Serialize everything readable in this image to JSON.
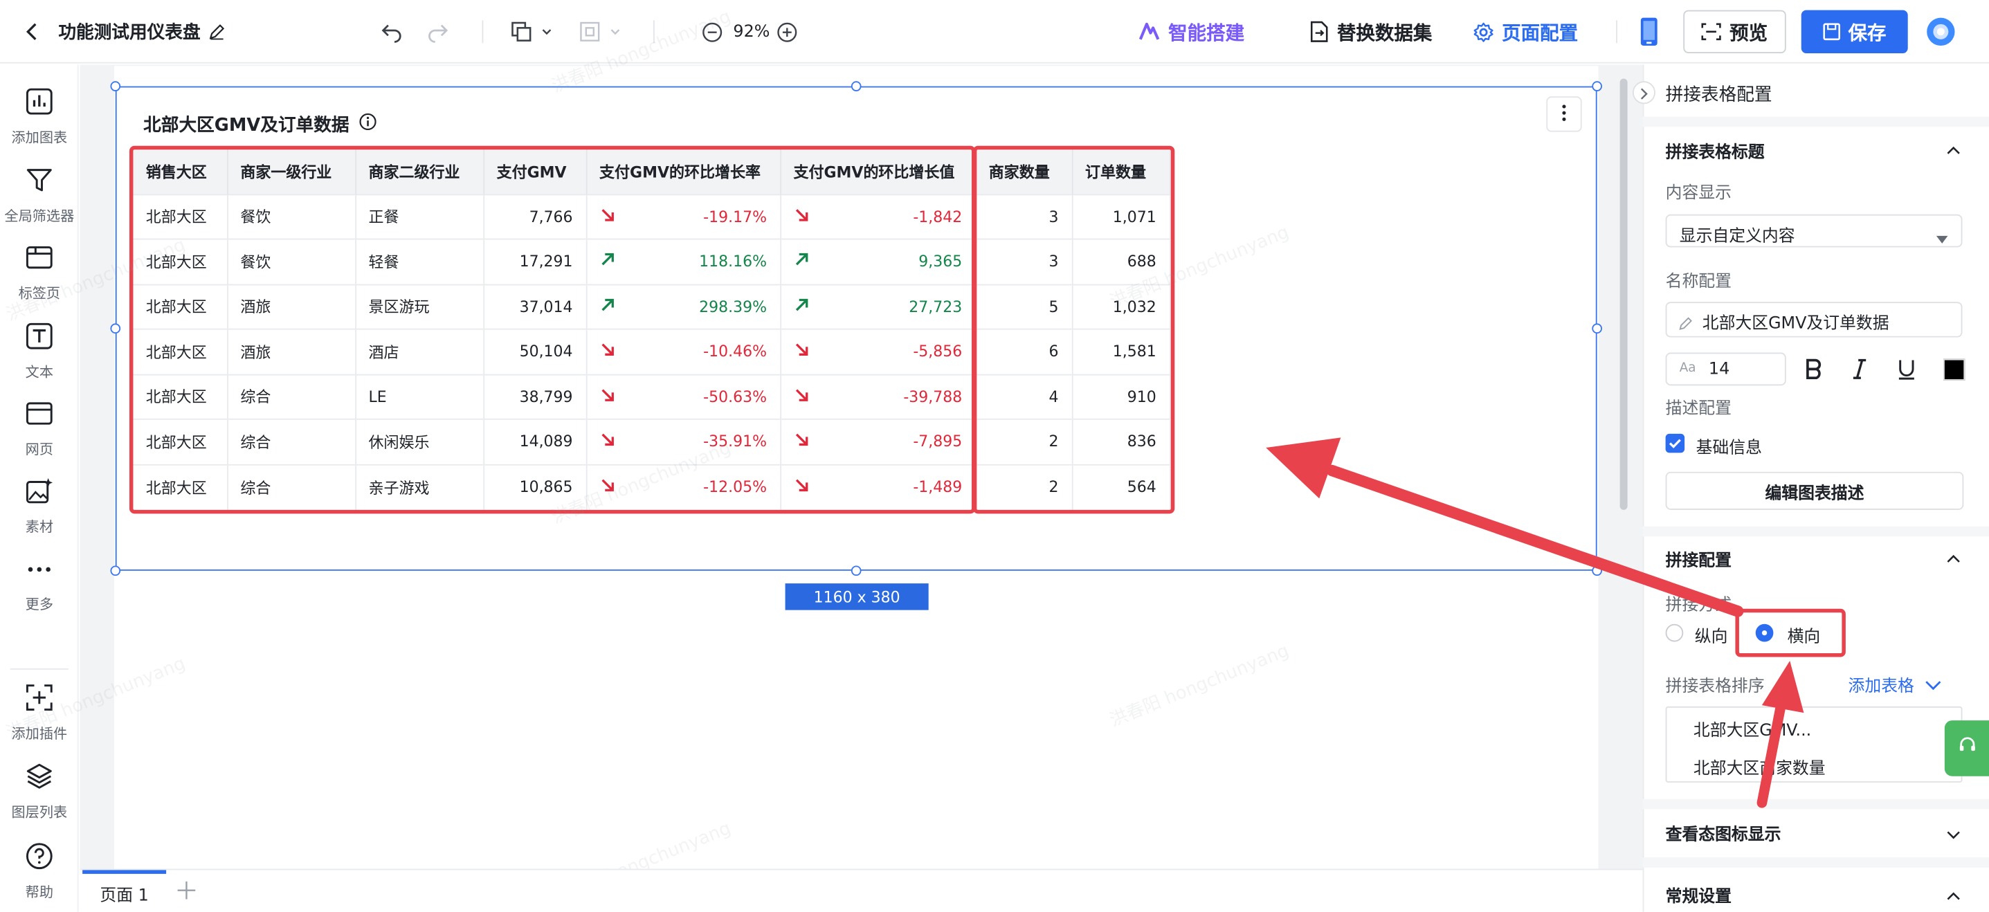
{
  "header": {
    "back_icon": "chevron-left-icon",
    "title": "功能测试用仪表盘",
    "zoom": "92%",
    "smart_build": "智能搭建",
    "replace_dataset": "替换数据集",
    "page_config": "页面配置",
    "preview": "预览",
    "save": "保存",
    "accent": "#2b6cf0",
    "smart_color": "#7a5af8"
  },
  "sidebar": [
    {
      "label": "添加图表",
      "icon": "bar-chart-icon"
    },
    {
      "label": "全局筛选器",
      "icon": "filter-icon"
    },
    {
      "label": "标签页",
      "icon": "tabs-icon"
    },
    {
      "label": "文本",
      "icon": "text-icon"
    },
    {
      "label": "网页",
      "icon": "webpage-icon"
    },
    {
      "label": "素材",
      "icon": "image-sparkle-icon"
    },
    {
      "label": "更多",
      "icon": "more-dots-icon"
    },
    {
      "label": "添加插件",
      "icon": "add-plugin-icon"
    },
    {
      "label": "图层列表",
      "icon": "layers-icon"
    },
    {
      "label": "帮助",
      "icon": "help-icon"
    }
  ],
  "card": {
    "title": "北部大区GMV及订单数据",
    "size_badge": "1160 x 380"
  },
  "table": {
    "columns": [
      "销售大区",
      "商家一级行业",
      "商家二级行业",
      "支付GMV",
      "支付GMV的环比增长率",
      "支付GMV的环比增长值",
      "商家数量",
      "订单数量"
    ],
    "rows": [
      {
        "region": "北部大区",
        "l1": "餐饮",
        "l2": "正餐",
        "gmv": "7,766",
        "rate": "-19.17%",
        "delta": "-1,842",
        "merchants": "3",
        "orders": "1,071",
        "dir": "down"
      },
      {
        "region": "北部大区",
        "l1": "餐饮",
        "l2": "轻餐",
        "gmv": "17,291",
        "rate": "118.16%",
        "delta": "9,365",
        "merchants": "3",
        "orders": "688",
        "dir": "up"
      },
      {
        "region": "北部大区",
        "l1": "酒旅",
        "l2": "景区游玩",
        "gmv": "37,014",
        "rate": "298.39%",
        "delta": "27,723",
        "merchants": "5",
        "orders": "1,032",
        "dir": "up"
      },
      {
        "region": "北部大区",
        "l1": "酒旅",
        "l2": "酒店",
        "gmv": "50,104",
        "rate": "-10.46%",
        "delta": "-5,856",
        "merchants": "6",
        "orders": "1,581",
        "dir": "down"
      },
      {
        "region": "北部大区",
        "l1": "综合",
        "l2": "LE",
        "gmv": "38,799",
        "rate": "-50.63%",
        "delta": "-39,788",
        "merchants": "4",
        "orders": "910",
        "dir": "down"
      },
      {
        "region": "北部大区",
        "l1": "综合",
        "l2": "休闲娱乐",
        "gmv": "14,089",
        "rate": "-35.91%",
        "delta": "-7,895",
        "merchants": "2",
        "orders": "836",
        "dir": "down"
      },
      {
        "region": "北部大区",
        "l1": "综合",
        "l2": "亲子游戏",
        "gmv": "10,865",
        "rate": "-12.05%",
        "delta": "-1,489",
        "merchants": "2",
        "orders": "564",
        "dir": "down"
      }
    ]
  },
  "panel": {
    "title": "拼接表格配置",
    "section_title": "拼接表格标题",
    "content_display_label": "内容显示",
    "content_display_value": "显示自定义内容",
    "name_config_label": "名称配置",
    "name_value": "北部大区GMV及订单数据",
    "font_size": "14",
    "desc_config_label": "描述配置",
    "basic_info": "基础信息",
    "edit_desc_button": "编辑图表描述",
    "join_config": "拼接配置",
    "join_mode_label": "拼接方式",
    "vertical": "纵向",
    "horizontal": "横向",
    "selected_mode": "横向",
    "sort_label": "拼接表格排序",
    "add_table": "添加表格",
    "sort_items": [
      "北部大区GMV...",
      "北部大区商家数量"
    ],
    "view_icon_display": "查看态图标显示",
    "general_settings": "常规设置"
  },
  "footer": {
    "page_tab": "页面 1",
    "add_icon": "plus-icon"
  },
  "watermark": "洪春阳 hongchunyang",
  "annotation_color": "#e8434c"
}
